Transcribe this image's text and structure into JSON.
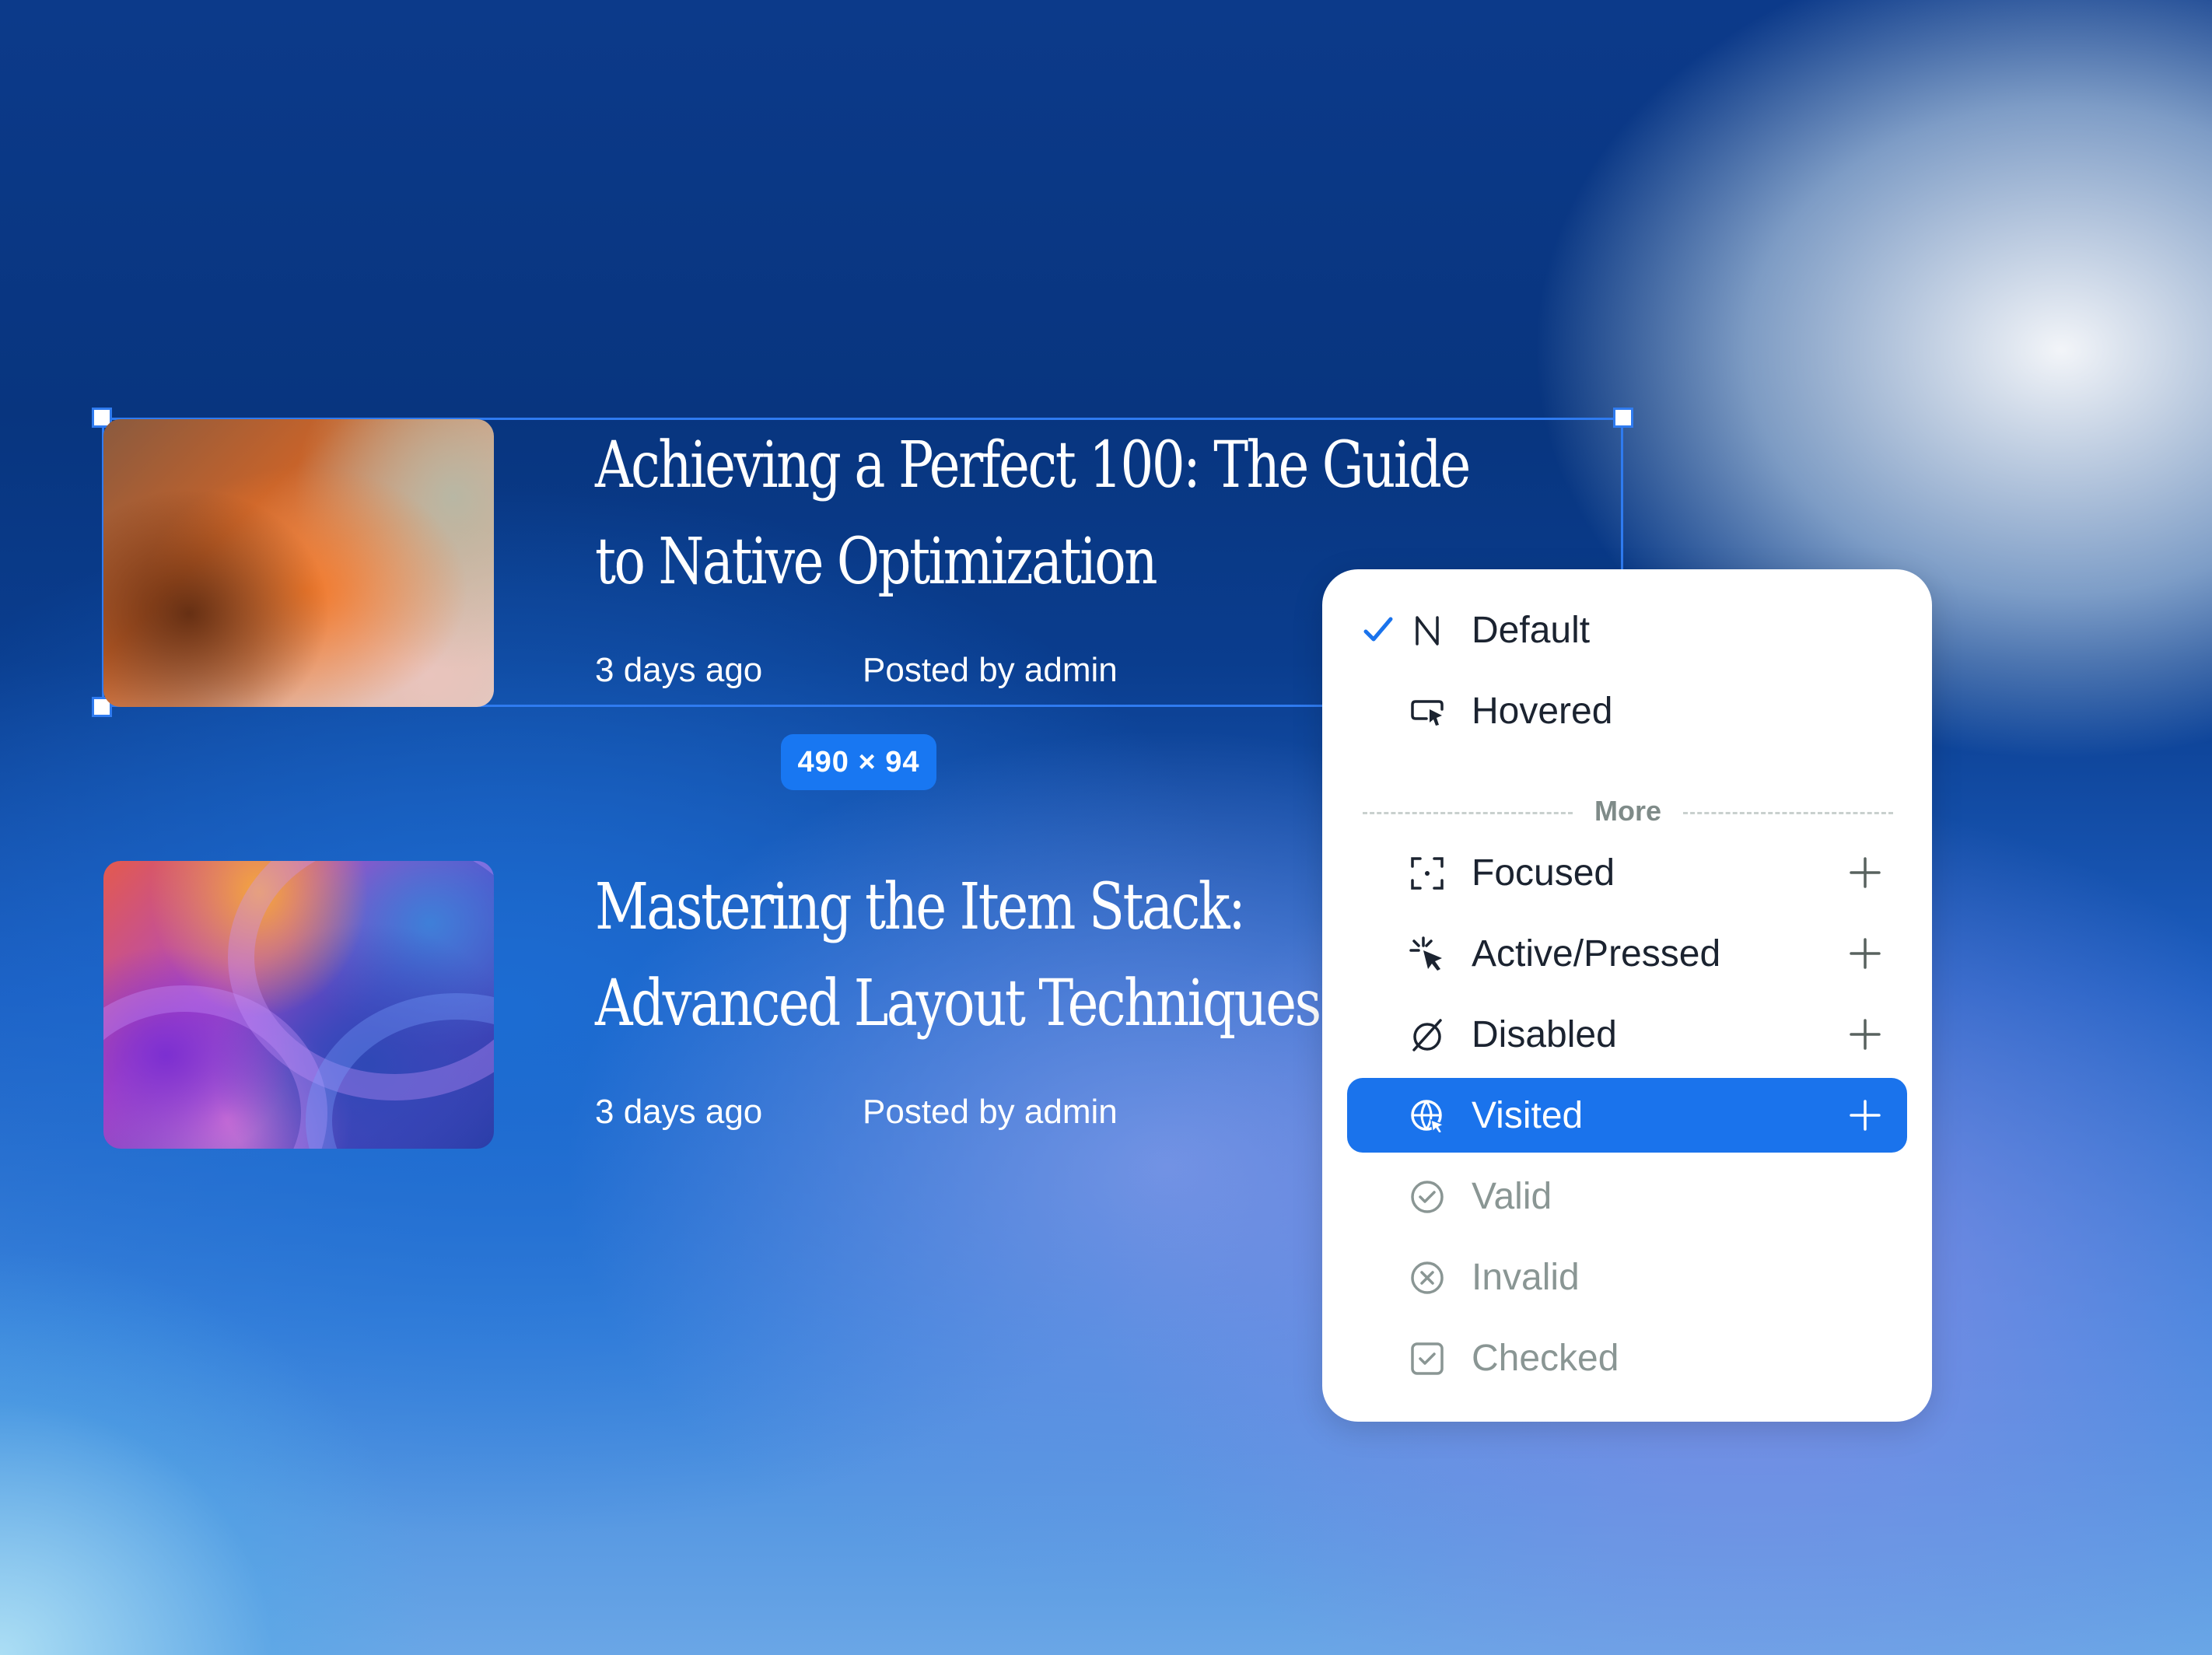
{
  "selection": {
    "size_label": "490 × 94"
  },
  "articles": [
    {
      "title_line1": "Achieving a Perfect 100: The Guide",
      "title_line2": "to Native Optimization",
      "time": "3 days ago",
      "author": "Posted by admin"
    },
    {
      "title_line1": "Mastering the Item Stack:",
      "title_line2": "Advanced Layout Techniques",
      "time": "3 days ago",
      "author": "Posted by admin"
    }
  ],
  "state_menu": {
    "selected": "Default",
    "items": [
      {
        "label": "Default",
        "icon": "n-letter-icon"
      },
      {
        "label": "Hovered",
        "icon": "cursor-hover-icon"
      }
    ],
    "more_label": "More",
    "more_items": [
      {
        "label": "Focused",
        "icon": "focus-frame-icon"
      },
      {
        "label": "Active/Pressed",
        "icon": "click-burst-icon"
      },
      {
        "label": "Disabled",
        "icon": "slashed-circle-icon"
      },
      {
        "label": "Visited",
        "icon": "globe-visited-icon"
      },
      {
        "label": "Valid",
        "icon": "check-circle-icon"
      },
      {
        "label": "Invalid",
        "icon": "x-circle-icon"
      },
      {
        "label": "Checked",
        "icon": "checkbox-icon"
      }
    ],
    "colors": {
      "accent": "#1a73ec",
      "muted_text": "#8a9694"
    }
  }
}
